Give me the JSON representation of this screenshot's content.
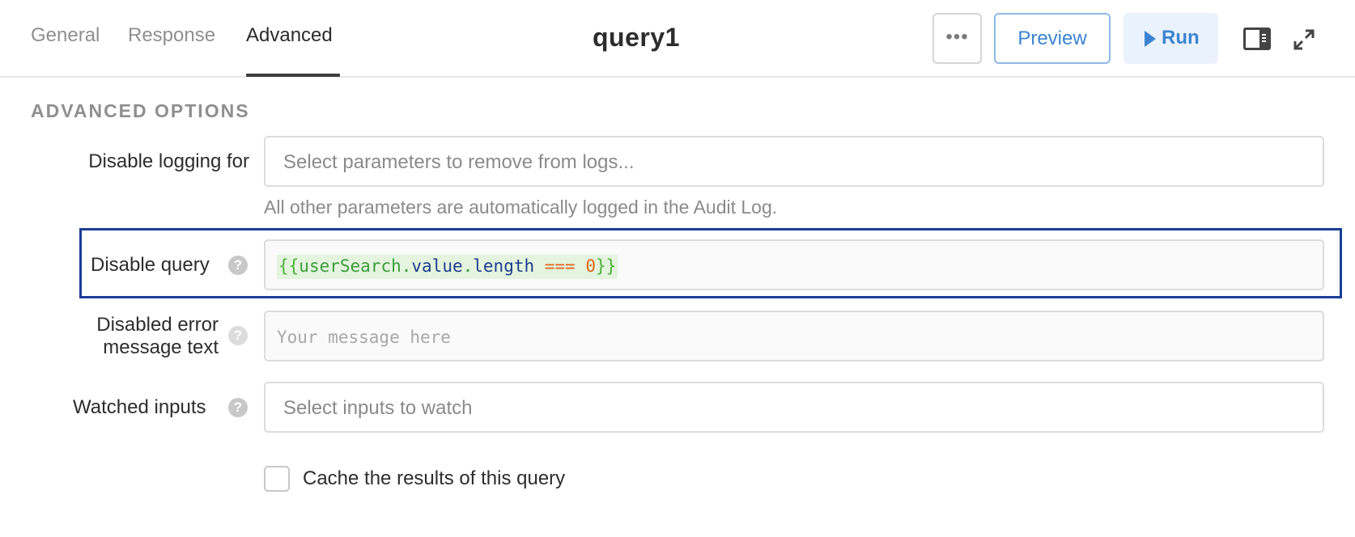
{
  "tabs": [
    {
      "label": "General",
      "active": false
    },
    {
      "label": "Response",
      "active": false
    },
    {
      "label": "Advanced",
      "active": true
    }
  ],
  "query_name": "query1",
  "toolbar": {
    "more_label": "•••",
    "preview_label": "Preview",
    "run_label": "Run",
    "icons": [
      "more-icon",
      "play-icon",
      "toggle-panel-icon",
      "expand-icon"
    ]
  },
  "advanced": {
    "section_title": "ADVANCED OPTIONS",
    "disable_logging": {
      "label": "Disable logging for",
      "placeholder": "Select parameters to remove from logs...",
      "hint": "All other parameters are automatically logged in the Audit Log."
    },
    "disable_query": {
      "label": "Disable query",
      "help": "?",
      "value": "{{userSearch.value.length === 0}}",
      "tokens": {
        "open": "{{",
        "var": "userSearch",
        "dot1": ".",
        "prop1": "value",
        "dot2": ".",
        "prop2": "length",
        "op": " === ",
        "num": "0",
        "close": "}}"
      }
    },
    "disabled_error": {
      "label_line1": "Disabled error",
      "label_line2": "message text",
      "help": "?",
      "placeholder": "Your message here"
    },
    "watched_inputs": {
      "label": "Watched inputs",
      "help": "?",
      "placeholder": "Select inputs to watch"
    },
    "cache": {
      "label": "Cache the results of this query",
      "checked": false
    }
  },
  "colors": {
    "accent_blue": "#3c84d2",
    "highlight_border": "#1b3e96",
    "code_green": "#4caf3a",
    "code_orange": "#e0661a"
  }
}
